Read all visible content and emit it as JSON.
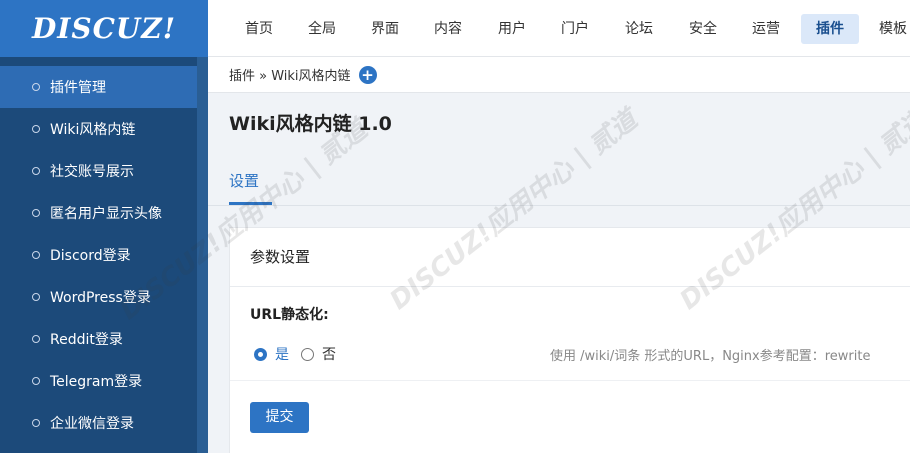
{
  "logo": {
    "text": "DISCUZ!"
  },
  "topnav": {
    "items": [
      "首页",
      "全局",
      "界面",
      "内容",
      "用户",
      "门户",
      "论坛",
      "安全",
      "运营",
      "插件",
      "模板"
    ],
    "active": "插件"
  },
  "sidebar": {
    "items": [
      {
        "label": "插件管理",
        "active": true
      },
      {
        "label": "Wiki风格内链"
      },
      {
        "label": "社交账号展示"
      },
      {
        "label": "匿名用户显示头像"
      },
      {
        "label": "Discord登录"
      },
      {
        "label": "WordPress登录"
      },
      {
        "label": "Reddit登录"
      },
      {
        "label": "Telegram登录"
      },
      {
        "label": "企业微信登录"
      }
    ]
  },
  "breadcrumb": {
    "text": "插件 » Wiki风格内链",
    "plus": "+"
  },
  "page": {
    "title": "Wiki风格内链 1.0",
    "tab": "设置"
  },
  "panel": {
    "title": "参数设置",
    "field_label": "URL静态化:",
    "radio_yes": "是",
    "radio_no": "否",
    "hint": "使用 /wiki/词条 形式的URL，Nginx参考配置：rewrite",
    "submit": "提交"
  },
  "watermark": {
    "text": "DISCUZ!应用中心 | 贰道"
  },
  "colors": {
    "brand": "#2d74c4",
    "sidebar": "#1c4a7a"
  }
}
